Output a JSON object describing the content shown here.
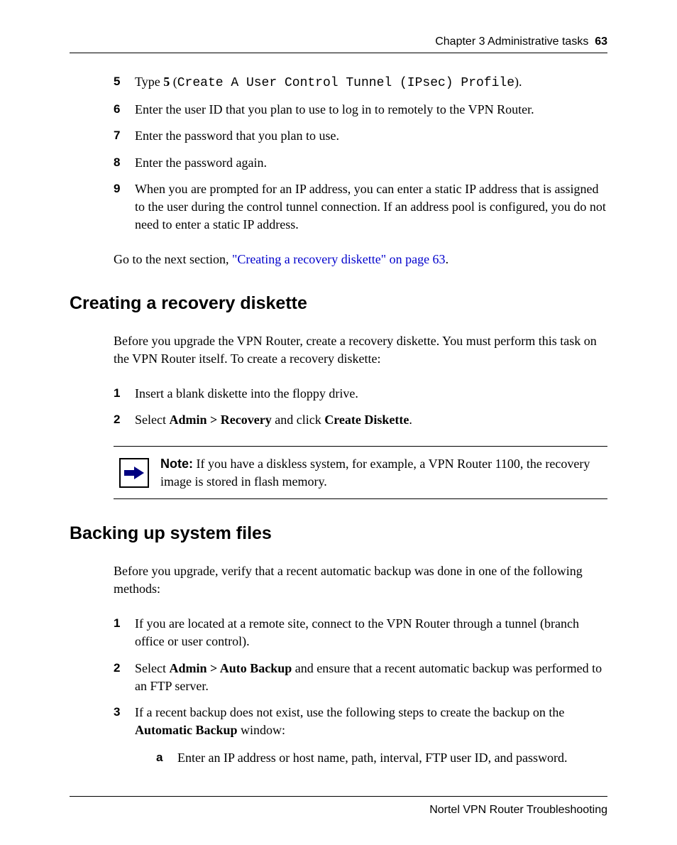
{
  "header": {
    "chapter": "Chapter 3  Administrative tasks",
    "page": "63"
  },
  "footer": "Nortel VPN Router Troubleshooting",
  "stepsA": {
    "s5": {
      "num": "5",
      "pre": "Type ",
      "bold": "5",
      "open": " (",
      "mono": "Create A User Control Tunnel (IPsec) Profile",
      "close": ")."
    },
    "s6": {
      "num": "6",
      "txt": "Enter the user ID that you plan to use to log in to remotely to the VPN Router."
    },
    "s7": {
      "num": "7",
      "txt": "Enter the password that you plan to use."
    },
    "s8": {
      "num": "8",
      "txt": "Enter the password again."
    },
    "s9": {
      "num": "9",
      "txt": "When you are prompted for an IP address, you can enter a static IP address that is assigned to the user during the control tunnel connection. If an address pool is configured, you do not need to enter a static IP address."
    }
  },
  "gotoPre": "Go to the next section, ",
  "gotoLink": "\"Creating a recovery diskette\" on page 63",
  "gotoPost": ".",
  "secB": {
    "title": "Creating a recovery diskette",
    "intro": "Before you upgrade the VPN Router, create a recovery diskette. You must perform this task on the VPN Router itself. To create a recovery diskette:",
    "s1": {
      "num": "1",
      "txt": "Insert a blank diskette into the floppy drive."
    },
    "s2": {
      "num": "2",
      "pre": "Select ",
      "b1": "Admin > Recovery",
      "mid": " and click ",
      "b2": "Create Diskette",
      "post": "."
    },
    "noteLabel": "Note:",
    "noteBody": " If you have a diskless system, for example, a VPN Router 1100, the recovery image is stored in flash memory."
  },
  "secC": {
    "title": "Backing up system files",
    "intro": "Before you upgrade, verify that a recent automatic backup was done in one of the following methods:",
    "s1": {
      "num": "1",
      "txt": "If you are located at a remote site, connect to the VPN Router through a tunnel (branch office or user control)."
    },
    "s2": {
      "num": "2",
      "pre": "Select ",
      "b1": "Admin > Auto Backup",
      "post": " and ensure that a recent automatic backup was performed to an FTP server."
    },
    "s3": {
      "num": "3",
      "pre": "If a recent backup does not exist, use the following steps to create the backup on the ",
      "b1": "Automatic Backup",
      "post": " window:",
      "a": {
        "sn": "a",
        "st": "Enter an IP address or host name, path, interval, FTP user ID, and password."
      }
    }
  }
}
